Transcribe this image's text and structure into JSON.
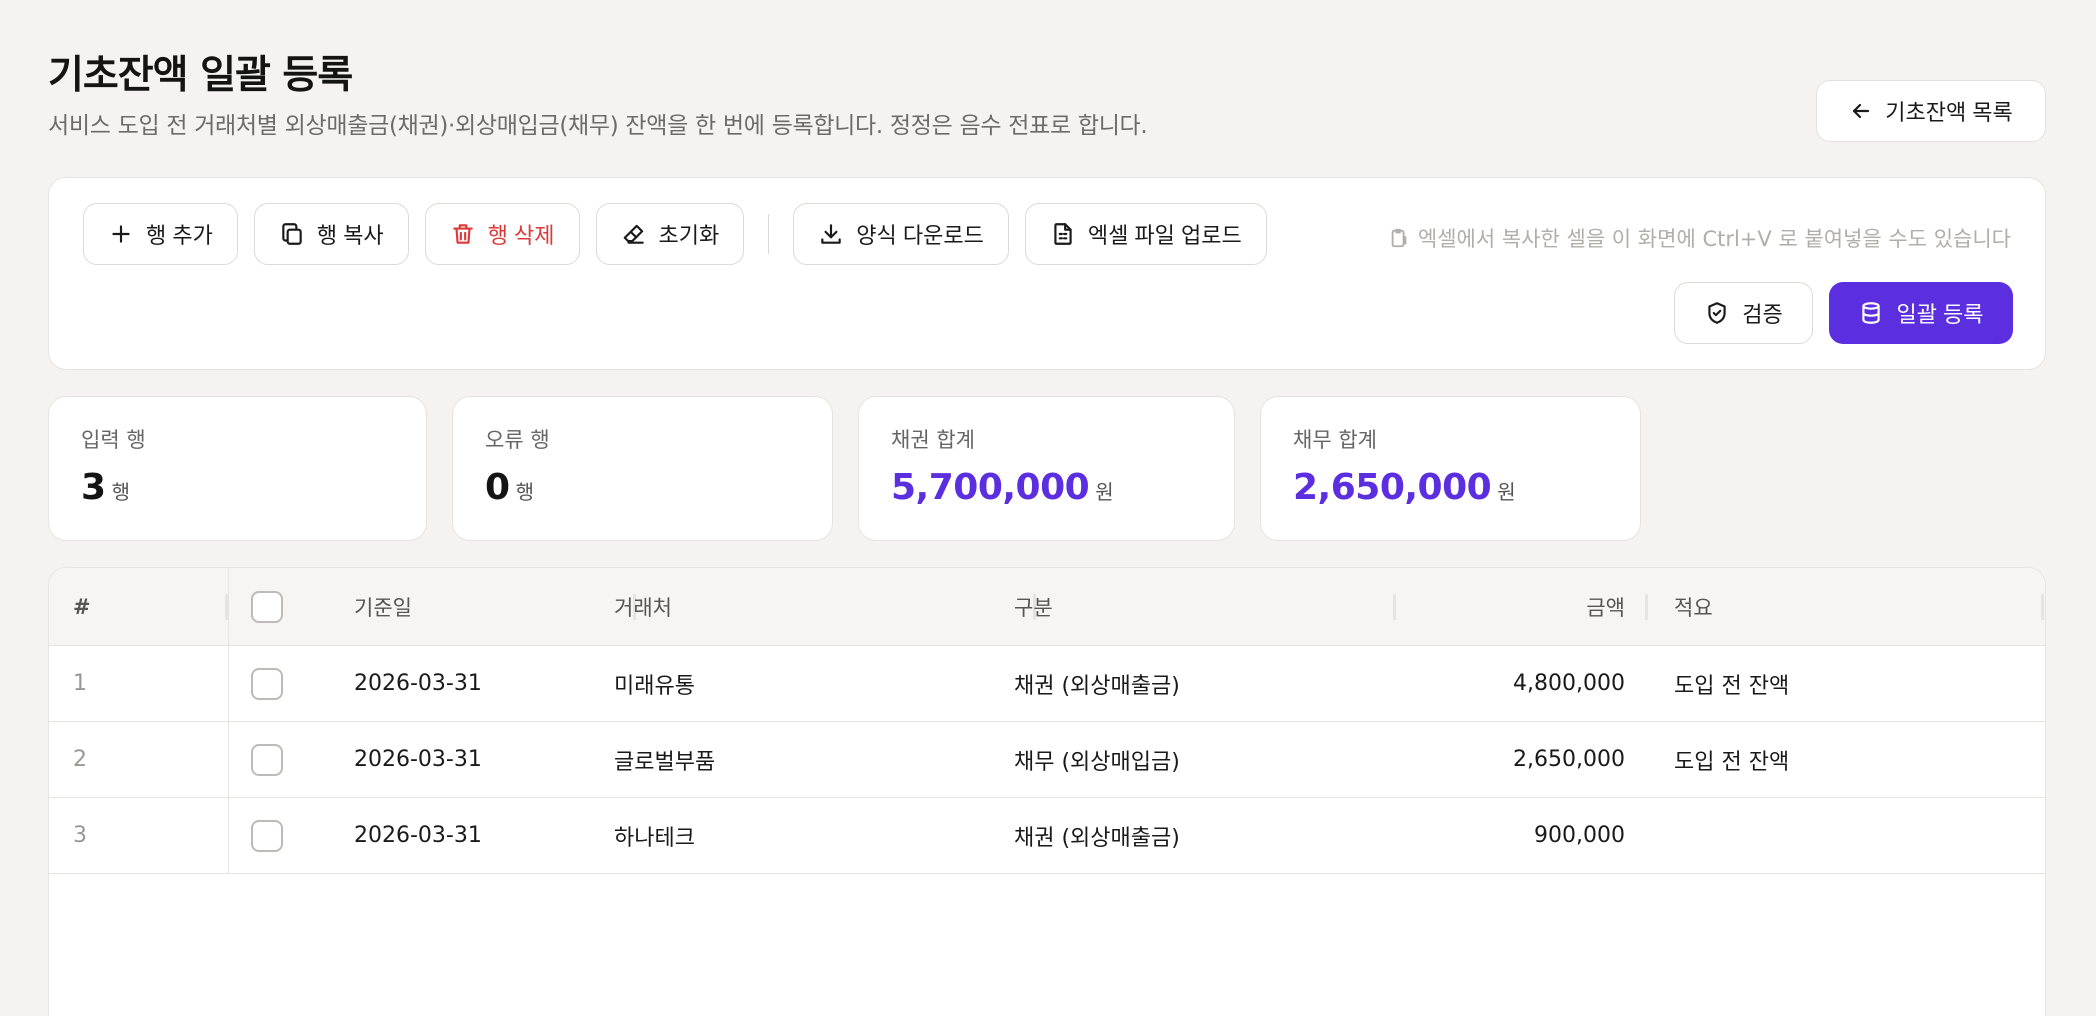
{
  "header": {
    "title": "기초잔액 일괄 등록",
    "subtitle": "서비스 도입 전 거래처별 외상매출금(채권)·외상매입금(채무) 잔액을 한 번에 등록합니다. 정정은 음수 전표로 합니다.",
    "back_label": "기초잔액 목록"
  },
  "toolbar": {
    "add_row": "행 추가",
    "copy_row": "행 복사",
    "delete_row": "행 삭제",
    "reset": "초기화",
    "download_template": "양식 다운로드",
    "upload_excel": "엑셀 파일 업로드",
    "paste_hint": "엑셀에서 복사한 셀을 이 화면에 Ctrl+V 로 붙여넣을 수도 있습니다",
    "verify": "검증",
    "submit": "일괄 등록"
  },
  "stats": {
    "rows": {
      "label": "입력 행",
      "value": "3",
      "unit": "행"
    },
    "errors": {
      "label": "오류 행",
      "value": "0",
      "unit": "행"
    },
    "receivable": {
      "label": "채권 합계",
      "value": "5,700,000",
      "unit": "원"
    },
    "payable": {
      "label": "채무 합계",
      "value": "2,650,000",
      "unit": "원"
    }
  },
  "table": {
    "columns": {
      "num": "#",
      "date": "기준일",
      "vendor": "거래처",
      "type": "구분",
      "amount": "금액",
      "memo": "적요"
    },
    "rows": [
      {
        "num": "1",
        "date": "2026-03-31",
        "vendor": "미래유통",
        "type": "채권 (외상매출금)",
        "amount": "4,800,000",
        "memo": "도입 전 잔액"
      },
      {
        "num": "2",
        "date": "2026-03-31",
        "vendor": "글로벌부품",
        "type": "채무 (외상매입금)",
        "amount": "2,650,000",
        "memo": "도입 전 잔액"
      },
      {
        "num": "3",
        "date": "2026-03-31",
        "vendor": "하나테크",
        "type": "채권 (외상매출금)",
        "amount": "900,000",
        "memo": ""
      }
    ]
  },
  "colors": {
    "accent": "#5b2ee0",
    "danger": "#dc3a3a",
    "background": "#f4f3f1"
  },
  "icons": {
    "back": "arrow-left-icon",
    "add": "plus-icon",
    "copy": "copy-icon",
    "delete": "trash-icon",
    "reset": "eraser-icon",
    "download": "download-icon",
    "upload": "file-spreadsheet-icon",
    "paste": "clipboard-icon",
    "verify": "shield-check-icon",
    "submit": "database-icon"
  }
}
